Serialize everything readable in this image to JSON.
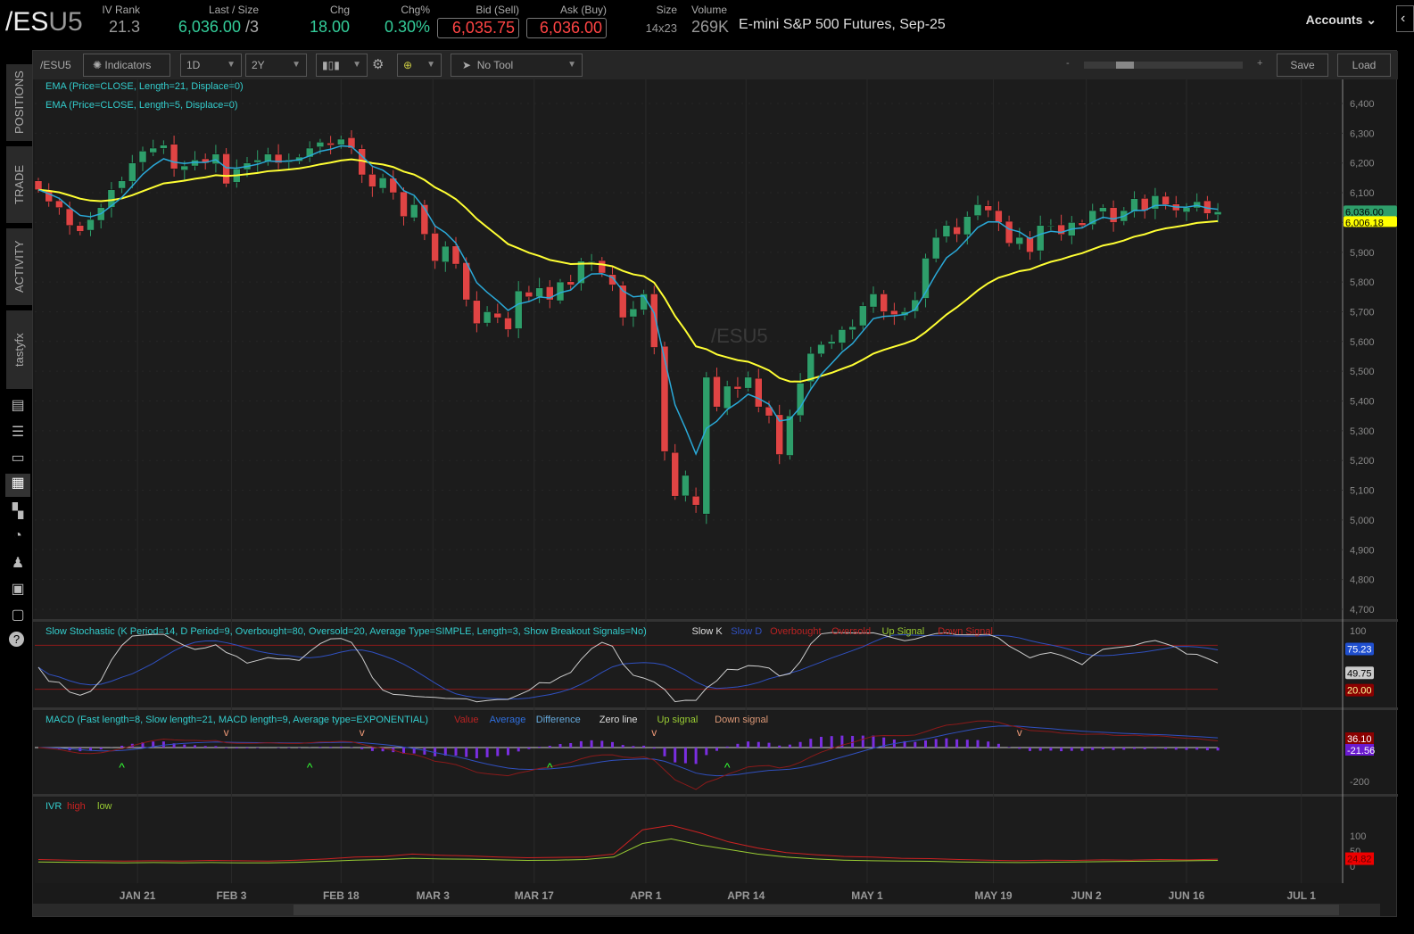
{
  "header": {
    "symbol_main": "/ES",
    "symbol_suffix": "U5",
    "iv_rank": {
      "label": "IV Rank",
      "value": "21.3"
    },
    "last": {
      "label": "Last / Size",
      "value": "6,036.00",
      "size": "/3"
    },
    "chg": {
      "label": "Chg",
      "value": "18.00"
    },
    "chgpct": {
      "label": "Chg%",
      "value": "0.30%"
    },
    "bid": {
      "label": "Bid (Sell)",
      "value": "6,035.75"
    },
    "ask": {
      "label": "Ask (Buy)",
      "value": "6,036.00"
    },
    "size": {
      "label": "Size",
      "value": "14x23"
    },
    "volume": {
      "label": "Volume",
      "value": "269K"
    },
    "description": "E-mini S&P 500 Futures, Sep-25",
    "accounts": "Accounts"
  },
  "sidebar": {
    "tabs": [
      "POSITIONS",
      "TRADE",
      "ACTIVITY",
      "tastyfx"
    ],
    "icons": [
      "news-icon",
      "watchlist-icon",
      "tv-icon",
      "chart-icon",
      "grid-icon",
      "history-icon",
      "community-icon",
      "calendar-icon",
      "fx-icon",
      "help-icon"
    ]
  },
  "toolbar": {
    "symbol": "/ESU5",
    "indicators": "Indicators",
    "aggregation": "1D",
    "range": "2Y",
    "tool": "No Tool",
    "zoom_minus": "-",
    "zoom_plus": "+",
    "zoom_level": 0.2,
    "save": "Save",
    "load": "Load"
  },
  "colors": {
    "up": "#2e9e6a",
    "down": "#e04444",
    "ema21": "#ffff33",
    "ema5": "#2aa9d8",
    "bg": "#1a1a1a"
  },
  "chart_data": {
    "type": "candlestick",
    "watermark": "/ESU5",
    "studies": [
      "EMA (Price=CLOSE, Length=21, Displace=0)",
      "EMA (Price=CLOSE, Length=5, Displace=0)"
    ],
    "y_ticks": [
      6400,
      6300,
      6200,
      6100,
      6000,
      5900,
      5800,
      5700,
      5600,
      5500,
      5400,
      5300,
      5200,
      5100,
      5000,
      4900,
      4800,
      4700
    ],
    "y_tick_labels": [
      "6,400",
      "6,300",
      "6,200",
      "6,100",
      "6,000",
      "5,900",
      "5,800",
      "5,700",
      "5,600",
      "5,500",
      "5,400",
      "5,300",
      "5,200",
      "5,100",
      "5,000",
      "4,900",
      "4,800",
      "4,700"
    ],
    "x_labels": [
      {
        "label": "JAN 21",
        "day": 9.5
      },
      {
        "label": "FEB 3",
        "day": 18.5
      },
      {
        "label": "FEB 18",
        "day": 29
      },
      {
        "label": "MAR 3",
        "day": 37.8
      },
      {
        "label": "MAR 17",
        "day": 47.5
      },
      {
        "label": "APR 1",
        "day": 58.2
      },
      {
        "label": "APR 14",
        "day": 67.8
      },
      {
        "label": "MAY 1",
        "day": 79.4
      },
      {
        "label": "MAY 19",
        "day": 91.5
      },
      {
        "label": "JUN 2",
        "day": 100.4
      },
      {
        "label": "JUN 16",
        "day": 110
      },
      {
        "label": "JUL 1",
        "day": 121
      }
    ],
    "closes": [
      6110,
      6070,
      6050,
      5990,
      5970,
      6010,
      6050,
      6110,
      6140,
      6200,
      6240,
      6250,
      6260,
      6180,
      6190,
      6210,
      6200,
      6230,
      6130,
      6180,
      6200,
      6210,
      6230,
      6200,
      6210,
      6220,
      6250,
      6270,
      6260,
      6280,
      6250,
      6160,
      6120,
      6150,
      6100,
      6020,
      6060,
      5960,
      5870,
      5920,
      5860,
      5740,
      5660,
      5700,
      5680,
      5640,
      5770,
      5750,
      5780,
      5740,
      5800,
      5790,
      5870,
      5870,
      5830,
      5790,
      5680,
      5710,
      5760,
      5580,
      5230,
      5080,
      5150,
      5050,
      5480,
      5380,
      5450,
      5440,
      5480,
      5380,
      5350,
      5220,
      5350,
      5460,
      5560,
      5590,
      5600,
      5640,
      5650,
      5720,
      5760,
      5700,
      5690,
      5700,
      5740,
      5880,
      5950,
      5990,
      5960,
      6020,
      6060,
      6040,
      6000,
      5930,
      5950,
      5900,
      5990,
      5990,
      5960,
      6000,
      5990,
      6040,
      6050,
      6000,
      6040,
      6080,
      6040,
      6090,
      6060,
      6040,
      6050,
      6070,
      6030,
      6036
    ],
    "last_label": "6,036.00",
    "ema21_label": "6,006.18",
    "stochastic": {
      "title": "Slow Stochastic (K Period=14, D Period=9, Overbought=80, Oversold=20, Average Type=SIMPLE, Length=3, Show Breakout Signals=No)",
      "legend": [
        "Slow K",
        "Slow D",
        "Overbought",
        "Oversold",
        "Up Signal",
        "Down Signal"
      ],
      "ticks": [
        "100"
      ],
      "labels": [
        "75.23",
        "49.75",
        "20.00"
      ],
      "overbought": 80,
      "oversold": 20
    },
    "macd": {
      "title": "MACD (Fast length=8, Slow length=21, MACD length=9, Average type=EXPONENTIAL)",
      "legend": [
        "Value",
        "Average",
        "Difference",
        "Zero line",
        "Up signal",
        "Down signal"
      ],
      "ticks": [
        "-200"
      ],
      "labels": [
        "36.10",
        "-21.56"
      ]
    },
    "ivr": {
      "title": "IVR",
      "legend": [
        "high",
        "low"
      ],
      "ticks": [
        "100",
        "50",
        "0"
      ],
      "label": "24.82",
      "high": [
        22,
        20,
        18,
        17,
        18,
        17,
        19,
        18,
        17,
        20,
        24,
        30,
        32,
        40,
        36,
        34,
        30,
        28,
        29,
        30,
        40,
        120,
        135,
        110,
        80,
        60,
        45,
        38,
        32,
        30,
        26,
        25,
        22,
        20,
        18,
        20,
        19,
        21,
        20,
        22,
        21,
        23
      ],
      "low": [
        14,
        13,
        12,
        11,
        12,
        11,
        12,
        11,
        11,
        13,
        16,
        20,
        22,
        26,
        24,
        23,
        21,
        19,
        20,
        22,
        30,
        75,
        90,
        70,
        55,
        40,
        30,
        24,
        20,
        18,
        17,
        16,
        14,
        13,
        12,
        13,
        14,
        15,
        16,
        17,
        18,
        19
      ]
    }
  }
}
